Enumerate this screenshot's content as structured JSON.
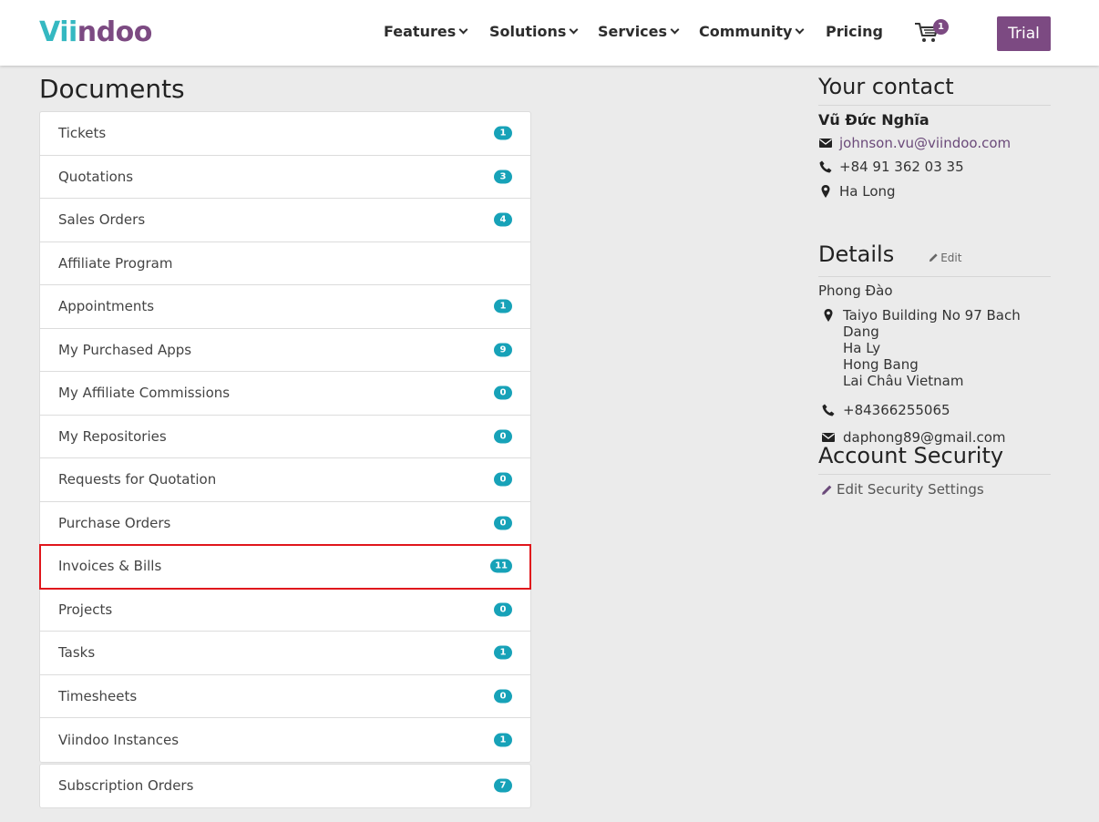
{
  "header": {
    "logo_part1": "Vii",
    "logo_part2": "n",
    "logo_part3": "doo",
    "nav": [
      "Features",
      "Solutions",
      "Services",
      "Community",
      "Pricing"
    ],
    "cart_count": "1",
    "trial_label": "Trial"
  },
  "documents": {
    "title": "Documents",
    "items": [
      {
        "label": "Tickets",
        "count": "1"
      },
      {
        "label": "Quotations",
        "count": "3"
      },
      {
        "label": "Sales Orders",
        "count": "4"
      },
      {
        "label": "Affiliate Program",
        "count": ""
      },
      {
        "label": "Appointments",
        "count": "1"
      },
      {
        "label": "My Purchased Apps",
        "count": "9"
      },
      {
        "label": "My Affiliate Commissions",
        "count": "0"
      },
      {
        "label": "My Repositories",
        "count": "0"
      },
      {
        "label": "Requests for Quotation",
        "count": "0"
      },
      {
        "label": "Purchase Orders",
        "count": "0"
      },
      {
        "label": "Invoices & Bills",
        "count": "11"
      },
      {
        "label": "Projects",
        "count": "0"
      },
      {
        "label": "Tasks",
        "count": "1"
      },
      {
        "label": "Timesheets",
        "count": "0"
      },
      {
        "label": "Viindoo Instances",
        "count": "1"
      }
    ],
    "extra_item": {
      "label": "Subscription Orders",
      "count": "7"
    }
  },
  "contact": {
    "title": "Your contact",
    "name": "Vũ Đức Nghĩa",
    "email": "johnson.vu@viindoo.com",
    "phone": "+84 91 362 03 35",
    "location": "Ha Long"
  },
  "details": {
    "title": "Details",
    "edit_label": "Edit",
    "name": "Phong Đào",
    "address_lines": [
      "Taiyo Building No 97 Bach Dang",
      "Ha Ly",
      "Hong Bang",
      "Lai Châu Vietnam"
    ],
    "phone": "+84366255065",
    "email": "daphong89@gmail.com"
  },
  "security": {
    "title": "Account Security",
    "edit_label": "Edit Security Settings"
  },
  "colors": {
    "brand_purple": "#7c4a82",
    "brand_teal": "#35b8c1",
    "badge": "#17a2b8",
    "highlight": "#e0161c"
  }
}
